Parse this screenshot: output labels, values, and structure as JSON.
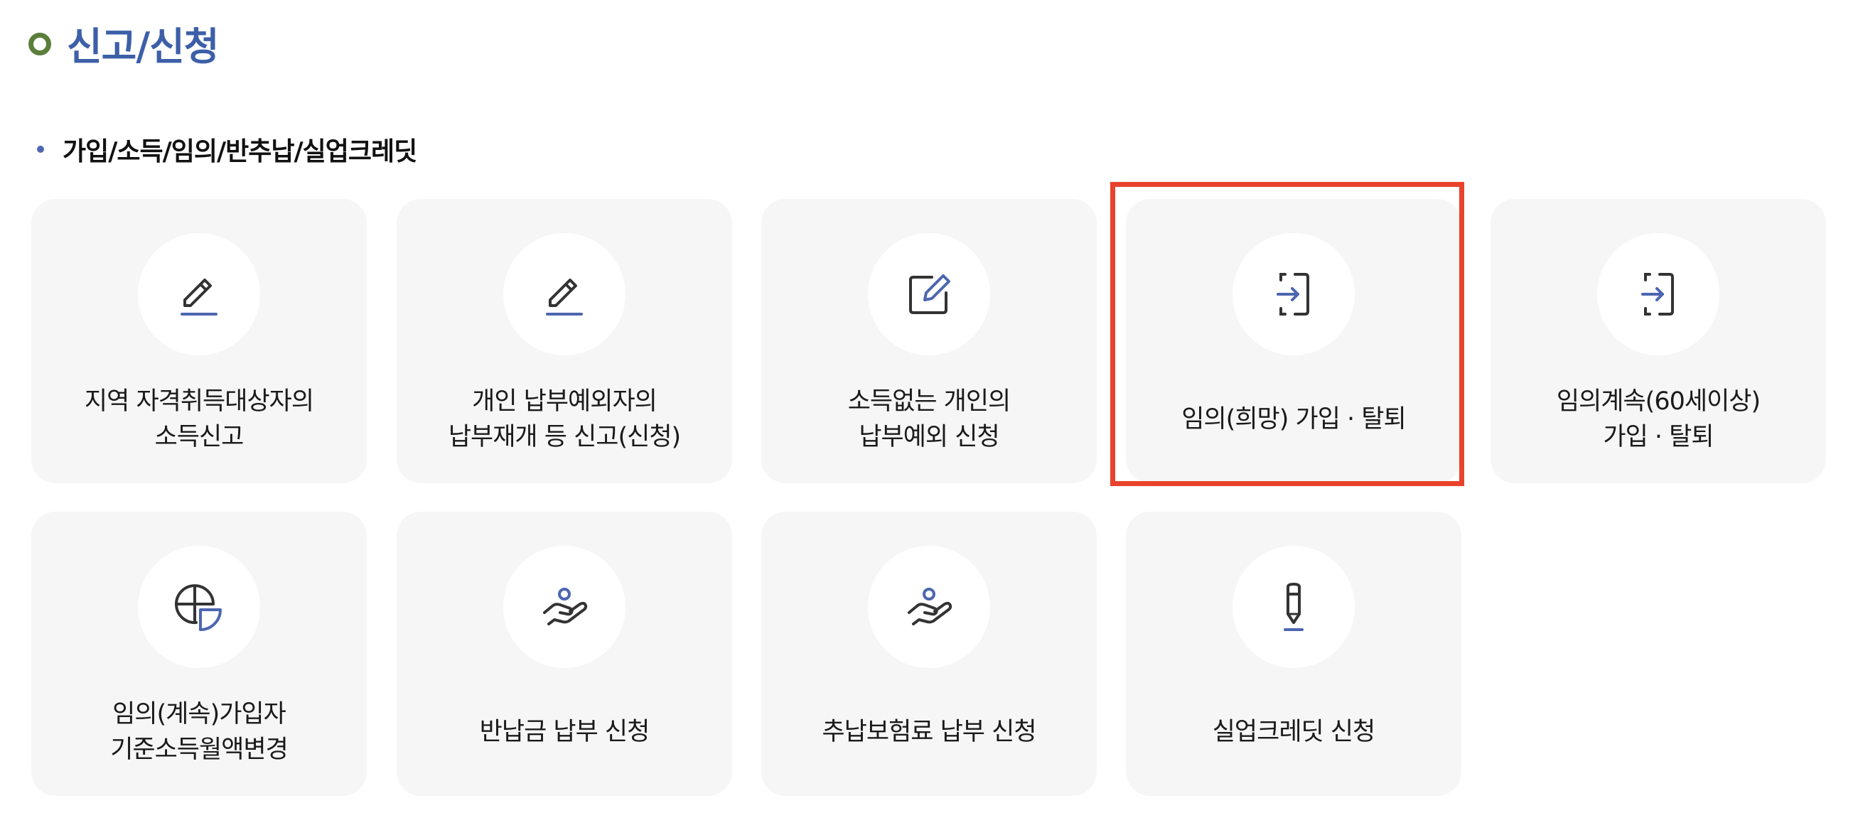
{
  "page": {
    "title": "신고/신청",
    "title_color": "#3d5fa8",
    "bullet_color": "#5b7f3a"
  },
  "section": {
    "label": "가입/소득/임의/반추납/실업크레딧"
  },
  "colors": {
    "icon_dark": "#333333",
    "icon_accent": "#4c66b0",
    "card_bg": "#f6f6f6",
    "highlight": "#e8432c"
  },
  "cards": [
    {
      "label": "지역 자격취득대상자의\n소득신고",
      "icon": "pencil-underline-icon"
    },
    {
      "label": "개인 납부예외자의\n납부재개 등 신고(신청)",
      "icon": "pencil-underline-icon"
    },
    {
      "label": "소득없는 개인의\n납부예외 신청",
      "icon": "edit-square-icon"
    },
    {
      "label": "임의(희망) 가입 · 탈퇴",
      "icon": "login-arrow-icon",
      "highlighted": true
    },
    {
      "label": "임의계속(60세이상)\n가입 · 탈퇴",
      "icon": "login-arrow-icon"
    },
    {
      "label": "임의(계속)가입자\n기준소득월액변경",
      "icon": "pie-chart-icon"
    },
    {
      "label": "반납금 납부 신청",
      "icon": "hand-person-icon"
    },
    {
      "label": "추납보험료 납부 신청",
      "icon": "hand-person-icon"
    },
    {
      "label": "실업크레딧 신청",
      "icon": "pen-icon"
    }
  ]
}
